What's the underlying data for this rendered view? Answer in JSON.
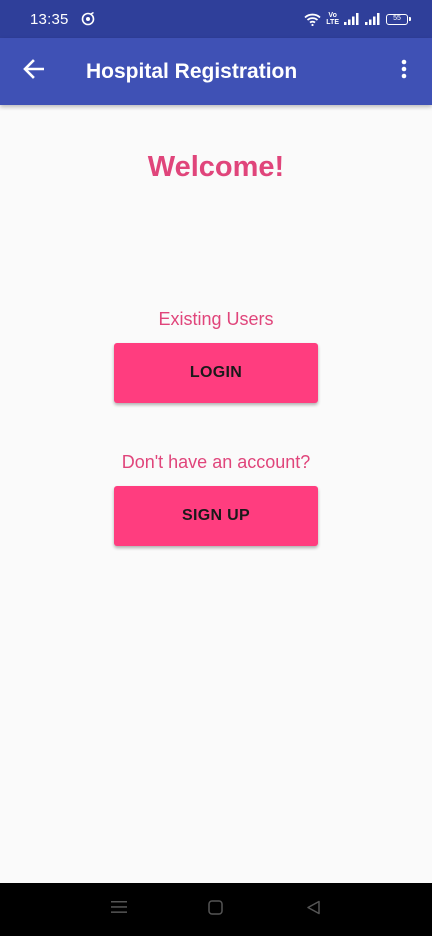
{
  "status_bar": {
    "time": "13:35",
    "volte_top": "Vo",
    "volte_bottom": "LTE",
    "battery": "55"
  },
  "app_bar": {
    "title": "Hospital Registration",
    "back_icon": "arrow-back-icon",
    "overflow_icon": "more-vert-icon"
  },
  "main": {
    "welcome": "Welcome!",
    "existing_users_label": "Existing Users",
    "login_button": "LOGIN",
    "no_account_label": "Don't have an account?",
    "signup_button": "SIGN UP"
  },
  "colors": {
    "status_bar": "#2f3f9a",
    "app_bar": "#3f51b5",
    "accent_text": "#e0457b",
    "button": "#ff3d7f",
    "background": "#fafafa"
  },
  "nav_bar": {
    "menu_icon": "menu-icon",
    "home_icon": "home-square-icon",
    "back_icon": "back-triangle-icon"
  }
}
